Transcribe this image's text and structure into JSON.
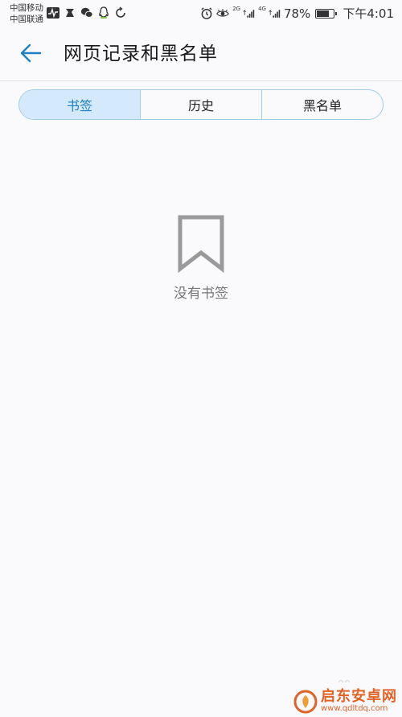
{
  "status_bar": {
    "carrier_1": "中国移动",
    "carrier_2": "中国联通",
    "net_1": "2G",
    "net_2": "4G",
    "battery_percent": "78%",
    "battery_level": 0.78,
    "time": "下午4:01",
    "left_icons": [
      "activity-icon",
      "app-icon",
      "wechat-icon",
      "qq-icon",
      "sync-icon"
    ],
    "right_icons": [
      "alarm-icon",
      "eye-comfort-icon",
      "signal-icon",
      "signal-icon",
      "battery-icon"
    ]
  },
  "header": {
    "title": "网页记录和黑名单",
    "back_icon": "arrow-left-icon"
  },
  "tabs": [
    {
      "label": "书签",
      "active": true
    },
    {
      "label": "历史",
      "active": false
    },
    {
      "label": "黑名单",
      "active": false
    }
  ],
  "empty_state": {
    "icon": "bookmark-icon",
    "text": "没有书签"
  },
  "watermark": {
    "brand": "启东安卓网",
    "url": "www.qdltdq.com"
  },
  "colors": {
    "accent": "#1f7fc4",
    "tab_active_bg": "#d4e9fb",
    "tab_border": "#9fcde6",
    "background": "#fafafd",
    "watermark": "#e05a1a"
  }
}
